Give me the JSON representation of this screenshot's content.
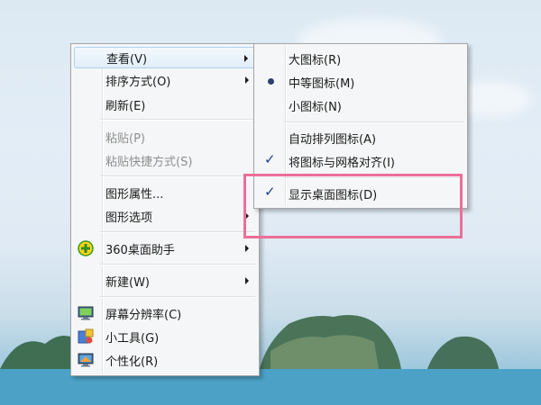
{
  "context_menu": {
    "items": [
      {
        "label": "查看(V)",
        "has_submenu": true,
        "state": "hover"
      },
      {
        "label": "排序方式(O)",
        "has_submenu": true
      },
      {
        "label": "刷新(E)"
      },
      {
        "label": "粘贴(P)",
        "disabled": true
      },
      {
        "label": "粘贴快捷方式(S)",
        "disabled": true
      },
      {
        "label": "图形属性..."
      },
      {
        "label": "图形选项",
        "has_submenu": true
      },
      {
        "label": "360桌面助手",
        "has_submenu": true,
        "icon": "360-plus-icon"
      },
      {
        "label": "新建(W)",
        "has_submenu": true
      },
      {
        "label": "屏幕分辨率(C)",
        "icon": "monitor-icon"
      },
      {
        "label": "小工具(G)",
        "icon": "gadgets-icon"
      },
      {
        "label": "个性化(R)",
        "icon": "personalize-icon"
      }
    ]
  },
  "view_submenu": {
    "items": [
      {
        "label": "大图标(R)"
      },
      {
        "label": "中等图标(M)",
        "mark": "radio"
      },
      {
        "label": "小图标(N)"
      },
      {
        "label": "自动排列图标(A)"
      },
      {
        "label": "将图标与网格对齐(I)",
        "mark": "check"
      },
      {
        "label": "显示桌面图标(D)",
        "mark": "check"
      }
    ],
    "check_glyph": "✓"
  },
  "highlight_color": "#ec6f98"
}
